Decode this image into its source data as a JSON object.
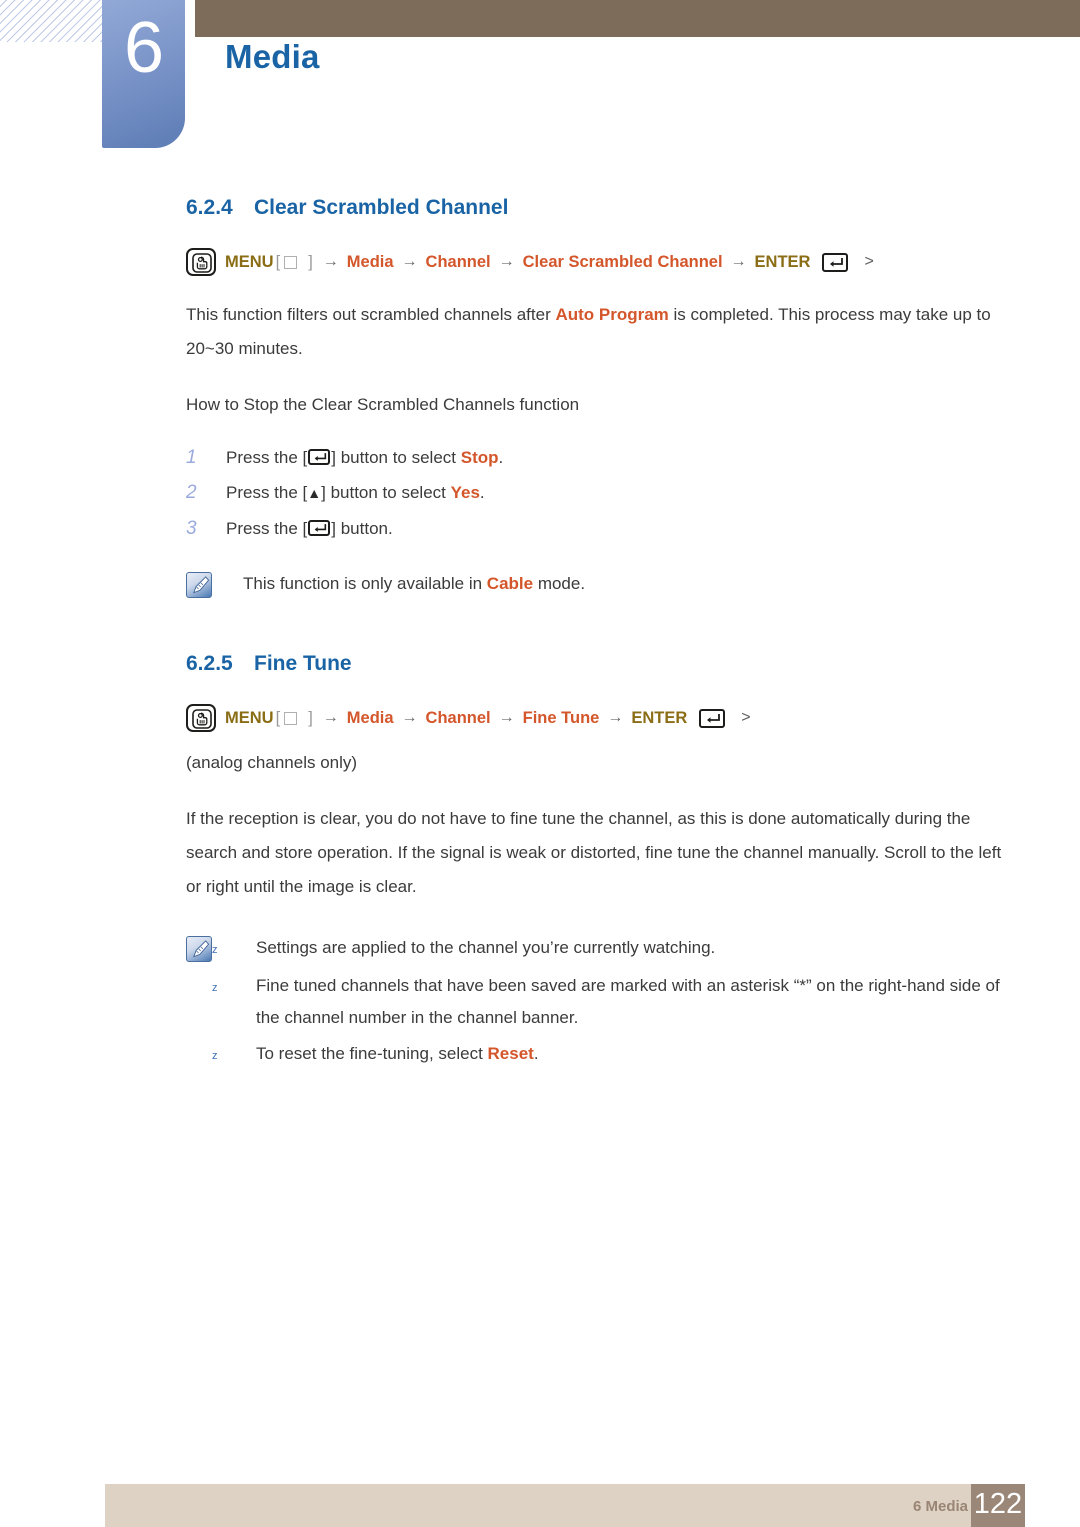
{
  "header": {
    "chapter_number": "6",
    "chapter_title": "Media"
  },
  "sections": [
    {
      "number": "6.2.4",
      "title": "Clear Scrambled Channel",
      "menu_path": {
        "menu_label": "MENU",
        "items": [
          "Media",
          "Channel",
          "Clear Scrambled Channel"
        ],
        "enter_label": "ENTER",
        "arrow": "→",
        "trailing": ">"
      },
      "paragraph_pre": "This function filters out scrambled channels after ",
      "paragraph_highlight": "Auto Program",
      "paragraph_post": " is completed. This process may take up to 20~30 minutes.",
      "subheading": "How to Stop the Clear Scrambled Channels function",
      "steps": [
        {
          "n": "1",
          "pre": "Press the [",
          "key": "enter-key",
          "post": "] button to select ",
          "highlight": "Stop",
          "tail": "."
        },
        {
          "n": "2",
          "pre": "Press the [",
          "key": "up-arrow-key",
          "post": "] button to select ",
          "highlight": "Yes",
          "tail": "."
        },
        {
          "n": "3",
          "pre": "Press the [",
          "key": "enter-key",
          "post": "] button.",
          "highlight": "",
          "tail": ""
        }
      ],
      "note": {
        "pre": "This function is only available in ",
        "highlight": "Cable",
        "post": " mode."
      }
    },
    {
      "number": "6.2.5",
      "title": "Fine Tune",
      "menu_path": {
        "menu_label": "MENU",
        "items": [
          "Media",
          "Channel",
          "Fine Tune"
        ],
        "enter_label": "ENTER",
        "arrow": "→",
        "trailing": ">"
      },
      "note_analog": "(analog channels only)",
      "paragraph": "If the reception is clear, you do not have to fine tune the channel, as this is done automatically during the search and store operation. If the signal is weak or distorted, fine tune the channel manually. Scroll to the left or right until the image is clear.",
      "notes": [
        {
          "bullet": "z",
          "pre": "Settings are applied to the channel you’re currently watching.",
          "highlight": "",
          "post": ""
        },
        {
          "bullet": "z",
          "pre": "Fine tuned channels that have been saved are marked with an asterisk “*” on the right-hand side of the channel number in the channel banner.",
          "highlight": "",
          "post": ""
        },
        {
          "bullet": "z",
          "pre": "To reset the fine-tuning, select ",
          "highlight": "Reset",
          "post": "."
        }
      ]
    }
  ],
  "footer": {
    "label": "6 Media",
    "page_number": "122"
  },
  "colors": {
    "heading_blue": "#1a64a5",
    "accent_orange": "#d4562b",
    "menu_gold": "#8a6d15",
    "top_bar_brown": "#7d6c59",
    "footer_bar": "#ddd2c3",
    "page_box": "#9b8777",
    "badge_blue": "#7b95c9",
    "step_number": "#9aaade"
  }
}
